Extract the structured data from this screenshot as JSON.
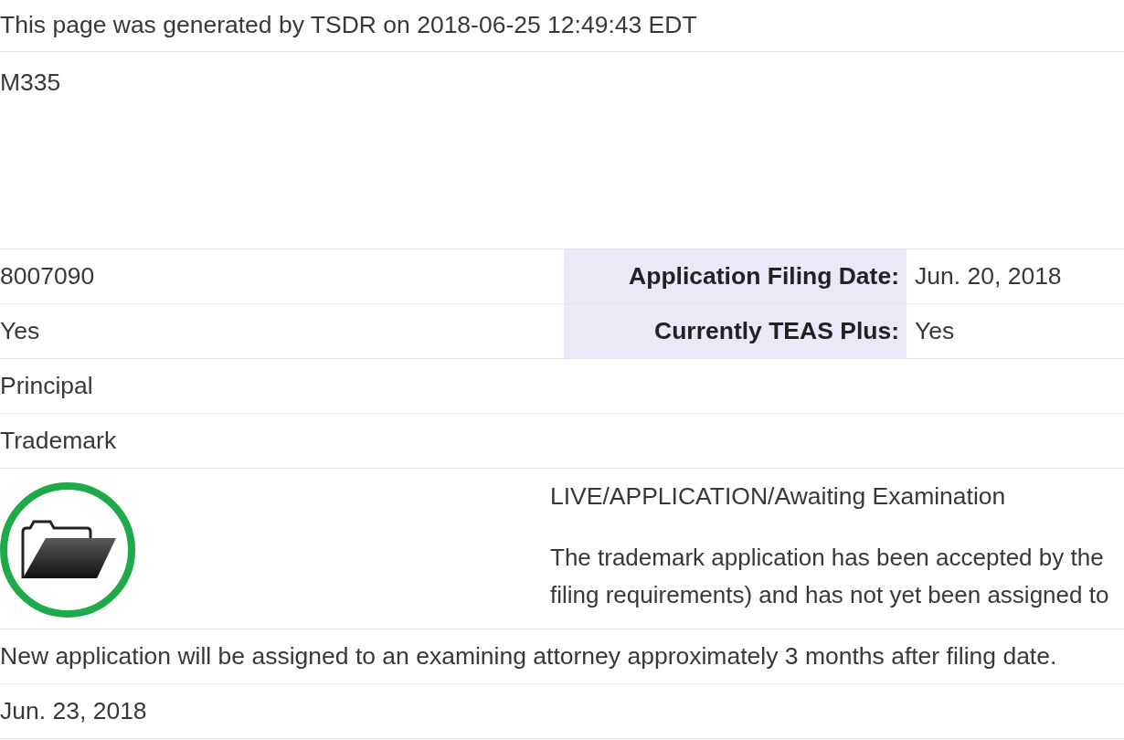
{
  "generated_note": "This page was generated by TSDR on 2018-06-25 12:49:43 EDT",
  "mark": {
    "text": "M335"
  },
  "rows": [
    {
      "kind": "pair",
      "value": "8007090",
      "label": "Application Filing Date:",
      "label_value": "Jun. 20, 2018"
    },
    {
      "kind": "pair",
      "value": "Yes",
      "label": "Currently TEAS Plus:",
      "label_value": "Yes"
    },
    {
      "kind": "single",
      "value": "Principal"
    },
    {
      "kind": "single",
      "value": "Trademark"
    },
    {
      "kind": "status",
      "status": "LIVE/APPLICATION/Awaiting Examination",
      "description_lines": [
        "The trademark application has been accepted by the",
        "filing requirements) and has not yet been assigned to"
      ]
    },
    {
      "kind": "single",
      "value": "New application will be assigned to an examining attorney approximately 3 months after filing date."
    },
    {
      "kind": "single",
      "value": "Jun. 23, 2018"
    }
  ]
}
